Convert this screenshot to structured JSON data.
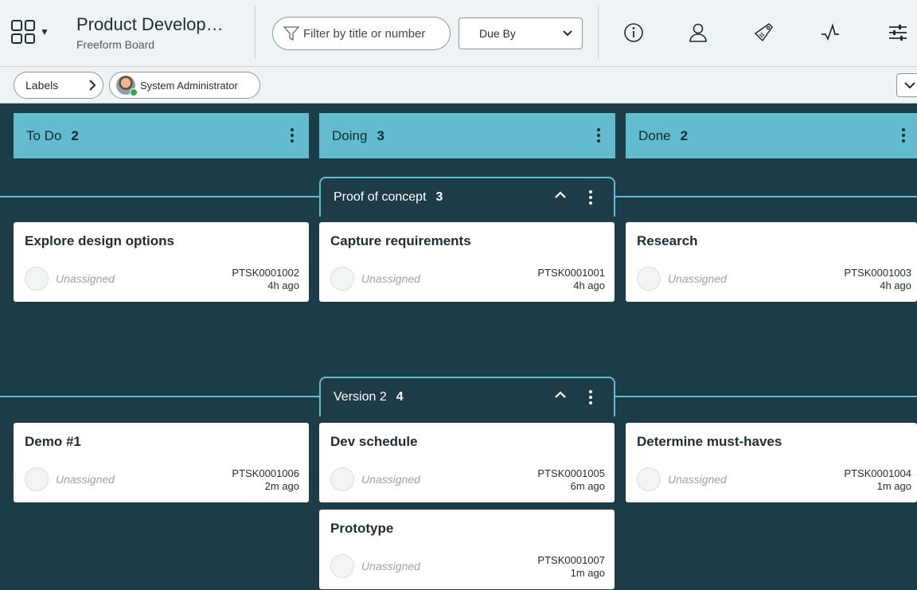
{
  "header": {
    "title": "Product Develop…",
    "subtitle": "Freeform Board",
    "filter_placeholder": "Filter by title or number",
    "sort_select": {
      "selected": "Due By",
      "options": [
        "Due By"
      ]
    },
    "toolbar_icons": [
      "info-icon",
      "user-icon",
      "tag-icon",
      "activity-icon",
      "settings-sliders-icon"
    ]
  },
  "labels_bar": {
    "labels_button": "Labels",
    "user_filter": "System Administrator"
  },
  "columns": [
    {
      "name": "To Do",
      "count": "2"
    },
    {
      "name": "Doing",
      "count": "3"
    },
    {
      "name": "Done",
      "count": "2"
    }
  ],
  "lanes": [
    {
      "name": "Proof of concept",
      "count": "3"
    },
    {
      "name": "Version 2",
      "count": "4"
    }
  ],
  "cards": [
    {
      "title": "Explore design options",
      "assignee": "Unassigned",
      "number": "PTSK0001002",
      "age": "4h ago"
    },
    {
      "title": "Capture requirements",
      "assignee": "Unassigned",
      "number": "PTSK0001001",
      "age": "4h ago"
    },
    {
      "title": "Research",
      "assignee": "Unassigned",
      "number": "PTSK0001003",
      "age": "4h ago"
    },
    {
      "title": "Demo #1",
      "assignee": "Unassigned",
      "number": "PTSK0001006",
      "age": "2m ago"
    },
    {
      "title": "Dev schedule",
      "assignee": "Unassigned",
      "number": "PTSK0001005",
      "age": "6m ago"
    },
    {
      "title": "Determine must-haves",
      "assignee": "Unassigned",
      "number": "PTSK0001004",
      "age": "1m ago"
    },
    {
      "title": "Prototype",
      "assignee": "Unassigned",
      "number": "PTSK0001007",
      "age": "1m ago"
    }
  ],
  "colors": {
    "board_bg": "#1c3d48",
    "column_header": "#63bccd",
    "header_bg": "#eef3f5",
    "card_bg": "#ffffff"
  }
}
